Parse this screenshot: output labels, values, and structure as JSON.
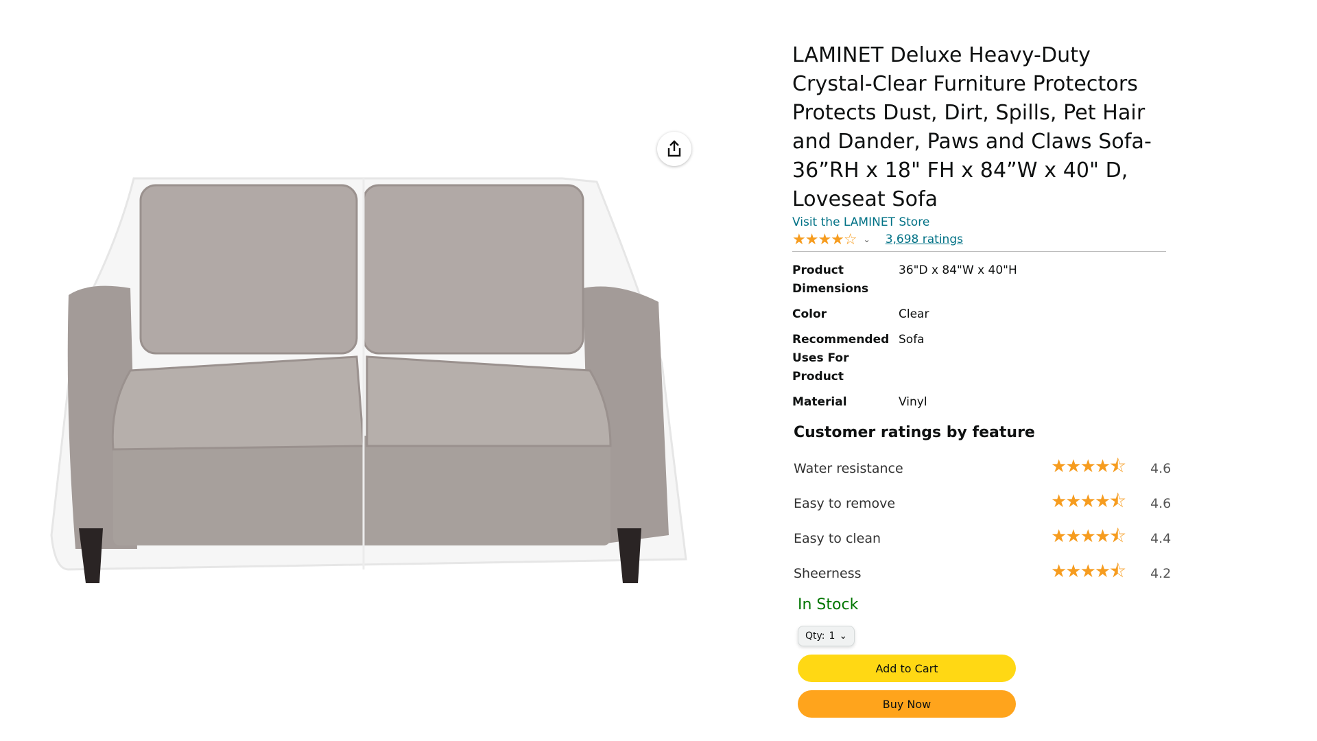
{
  "product": {
    "title": "LAMINET Deluxe Heavy-Duty Crystal-Clear Furniture Protectors Protects Dust, Dirt, Spills, Pet Hair and Dander, Paws and Claws Sofa-36”RH x 18\" FH x 84”W x 40\" D, Loveseat Sofa",
    "store_link": "Visit the LAMINET Store",
    "rating_stars": "★★★★☆",
    "ratings_count": "3,698 ratings",
    "image_icon": "share-icon"
  },
  "specs": [
    {
      "key": "Product Dimensions",
      "value": "36\"D x 84\"W x 40\"H"
    },
    {
      "key": "Color",
      "value": "Clear"
    },
    {
      "key": "Recommended Uses For Product",
      "value": "Sofa"
    },
    {
      "key": "Material",
      "value": "Vinyl"
    }
  ],
  "feature_ratings": {
    "heading": "Customer ratings by feature",
    "items": [
      {
        "name": "Water resistance",
        "stars": "★★★★⯪",
        "value": "4.6"
      },
      {
        "name": "Easy to remove",
        "stars": "★★★★⯪",
        "value": "4.6"
      },
      {
        "name": "Easy to clean",
        "stars": "★★★★⯪",
        "value": "4.4"
      },
      {
        "name": "Sheerness",
        "stars": "★★★★⯪",
        "value": "4.2"
      }
    ]
  },
  "buy_box": {
    "stock": "In Stock",
    "qty_label": "Qty:",
    "qty_value": "1",
    "add_to_cart": "Add to Cart",
    "buy_now": "Buy Now"
  },
  "colors": {
    "link": "#007185",
    "star": "#f69c1f",
    "in_stock": "#007600",
    "add_to_cart": "#ffd814",
    "buy_now": "#ffa41c"
  }
}
